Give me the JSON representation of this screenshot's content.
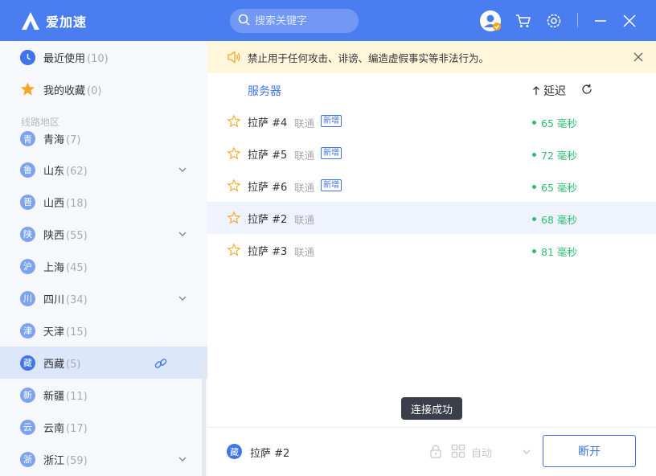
{
  "app": {
    "title": "爱加速"
  },
  "search": {
    "placeholder": "搜索关键字"
  },
  "sidebar": {
    "recent": {
      "label": "最近使用",
      "count": "(10)"
    },
    "favorites": {
      "label": "我的收藏",
      "count": "(0)"
    },
    "section_label": "线路地区",
    "regions": [
      {
        "icon": "青",
        "label": "青海",
        "count": "(7)"
      },
      {
        "icon": "鲁",
        "label": "山东",
        "count": "(62)"
      },
      {
        "icon": "晋",
        "label": "山西",
        "count": "(18)"
      },
      {
        "icon": "陕",
        "label": "陕西",
        "count": "(55)"
      },
      {
        "icon": "沪",
        "label": "上海",
        "count": "(45)"
      },
      {
        "icon": "川",
        "label": "四川",
        "count": "(34)"
      },
      {
        "icon": "津",
        "label": "天津",
        "count": "(15)"
      },
      {
        "icon": "藏",
        "label": "西藏",
        "count": "(5)"
      },
      {
        "icon": "新",
        "label": "新疆",
        "count": "(11)"
      },
      {
        "icon": "云",
        "label": "云南",
        "count": "(17)"
      },
      {
        "icon": "浙",
        "label": "浙江",
        "count": "(59)"
      }
    ]
  },
  "notice": {
    "text": "禁止用于任何攻击、诽谤、编造虚假事实等非法行为。"
  },
  "table": {
    "col_server": "服务器",
    "col_latency": "延迟",
    "rows": [
      {
        "name": "拉萨 #4",
        "isp": "联通",
        "badge": "新增",
        "latency": "65 毫秒"
      },
      {
        "name": "拉萨 #5",
        "isp": "联通",
        "badge": "新增",
        "latency": "72 毫秒"
      },
      {
        "name": "拉萨 #6",
        "isp": "联通",
        "badge": "新增",
        "latency": "65 毫秒"
      },
      {
        "name": "拉萨 #2",
        "isp": "联通",
        "badge": "",
        "latency": "68 毫秒"
      },
      {
        "name": "拉萨 #3",
        "isp": "联通",
        "badge": "",
        "latency": "81 毫秒"
      }
    ]
  },
  "toast": {
    "text": "连接成功"
  },
  "bottom": {
    "current_icon": "藏",
    "current_name": "拉萨 #2",
    "mode": "自动",
    "disconnect_label": "断开"
  },
  "colors": {
    "accent": "#3f74ea",
    "titlebar": "#4a7df0",
    "latency_good": "#2bbf6f",
    "notice_bg": "#fff6dc"
  }
}
